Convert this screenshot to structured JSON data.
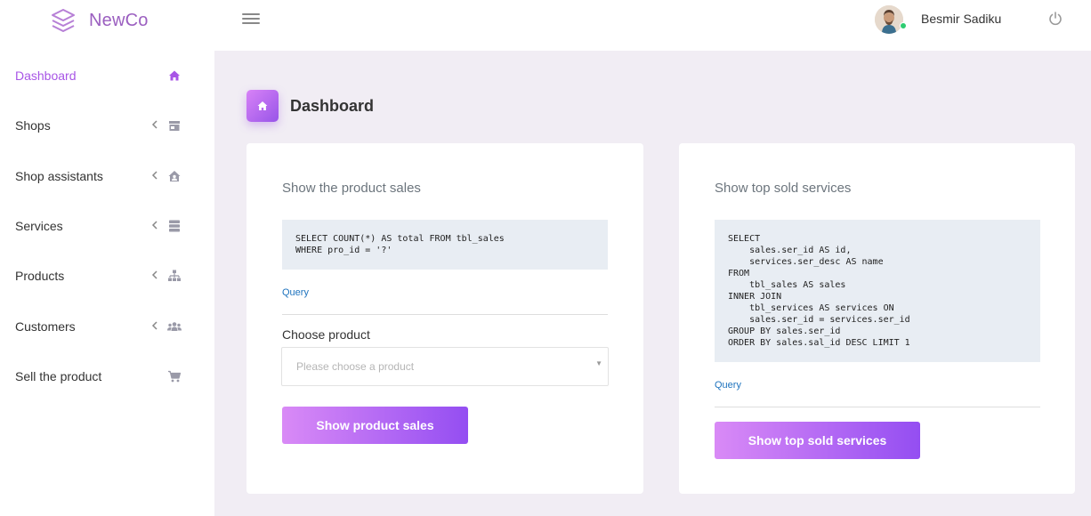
{
  "app": {
    "name": "NewCo"
  },
  "header": {
    "user_name": "Besmir Sadiku"
  },
  "sidebar": {
    "items": [
      {
        "label": "Dashboard",
        "icon": "home-icon",
        "active": true,
        "has_submenu": false
      },
      {
        "label": "Shops",
        "icon": "store-icon",
        "active": false,
        "has_submenu": true
      },
      {
        "label": "Shop assistants",
        "icon": "house-user-icon",
        "active": false,
        "has_submenu": true
      },
      {
        "label": "Services",
        "icon": "server-icon",
        "active": false,
        "has_submenu": true
      },
      {
        "label": "Products",
        "icon": "sitemap-icon",
        "active": false,
        "has_submenu": true
      },
      {
        "label": "Customers",
        "icon": "users-icon",
        "active": false,
        "has_submenu": true
      },
      {
        "label": "Sell the product",
        "icon": "cart-icon",
        "active": false,
        "has_submenu": false
      }
    ]
  },
  "page": {
    "title": "Dashboard"
  },
  "cards": {
    "product_sales": {
      "title": "Show the product sales",
      "code_lines": [
        "SELECT COUNT(*) AS total FROM tbl_sales",
        "WHERE pro_id = '?'"
      ],
      "query_link": "Query",
      "field_label": "Choose product",
      "select_placeholder": "Please choose a product",
      "button_label": "Show product sales"
    },
    "top_services": {
      "title": "Show top sold services",
      "code_lines": [
        "SELECT",
        "    sales.ser_id AS id,",
        "    services.ser_desc AS name",
        "FROM",
        "    tbl_sales AS sales",
        "INNER JOIN",
        "    tbl_services AS services ON",
        "    sales.ser_id = services.ser_id",
        "GROUP BY sales.ser_id",
        "ORDER BY sales.sal_id DESC LIMIT 1"
      ],
      "query_link": "Query",
      "button_label": "Show top sold services"
    }
  },
  "colors": {
    "accent": "#a855e6",
    "brand": "#9b5fc0",
    "button_gradient_start": "#d98af6",
    "button_gradient_end": "#944ef2",
    "page_background": "#f1edf4",
    "code_background": "#e8edf3",
    "link": "#1e73be",
    "online_status": "#2ecc71"
  }
}
